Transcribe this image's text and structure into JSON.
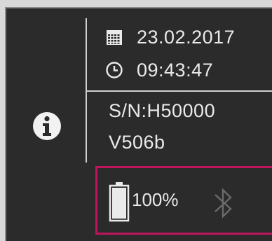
{
  "status": {
    "date": "23.02.2017",
    "time": "09:43:47",
    "serial": "S/N:H50000",
    "version": "V506b",
    "battery_percent": "100%",
    "battery_level": 1.0
  },
  "icons": {
    "info": "info-icon",
    "calendar": "calendar-icon",
    "clock": "clock-icon",
    "battery": "battery-icon",
    "bluetooth": "bluetooth-icon"
  },
  "colors": {
    "highlight": "#c0145c",
    "background": "#2b2b2b",
    "text": "#eaeaea",
    "bluetooth_inactive": "#6a6a6a"
  }
}
